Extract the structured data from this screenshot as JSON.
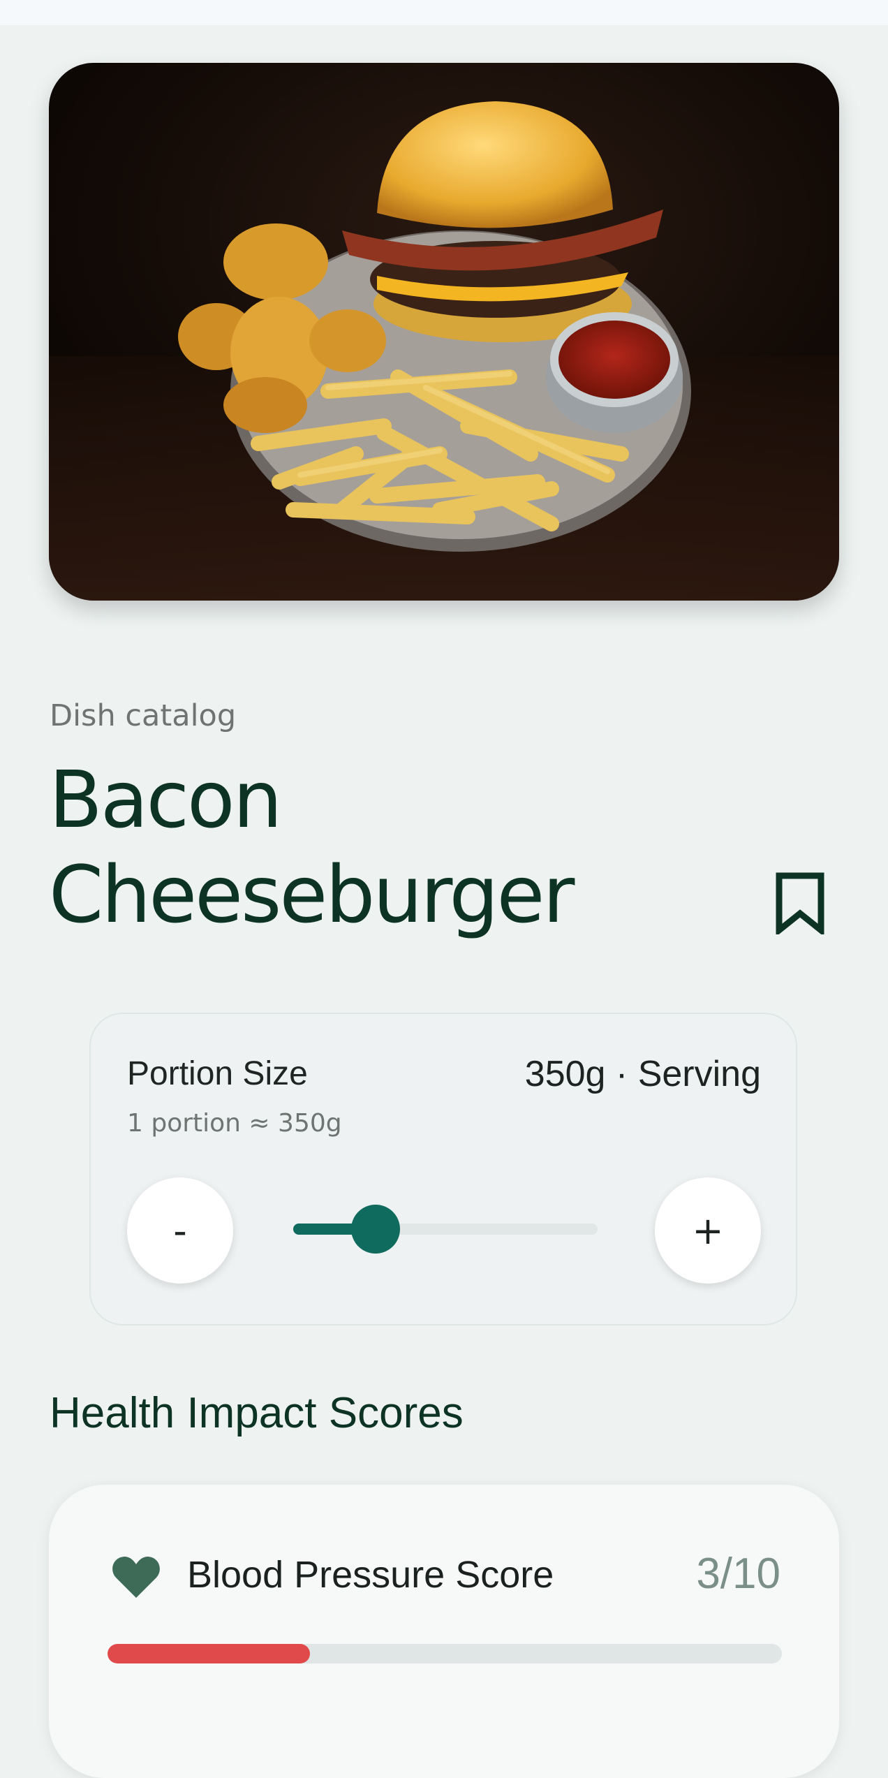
{
  "hero": {
    "image_description_icon": "burger-plate-photo"
  },
  "dish": {
    "catalog_label": "Dish catalog",
    "title": "Bacon Cheeseburger",
    "bookmark_icon": "bookmark-icon"
  },
  "portion": {
    "title": "Portion Size",
    "value": "350g · Serving",
    "subtitle": "1 portion ≈ 350g",
    "minus_label": "-",
    "plus_label": "+",
    "slider_fraction": 0.27
  },
  "health": {
    "heading": "Health Impact Scores",
    "scores": [
      {
        "label": "Blood Pressure Score",
        "value": "3/10",
        "fraction": 0.3,
        "color": "#e04a4a",
        "icon": "heart-icon"
      }
    ]
  },
  "colors": {
    "accent": "#0e6b5e",
    "title": "#0d3324",
    "score_bad": "#e04a4a"
  }
}
